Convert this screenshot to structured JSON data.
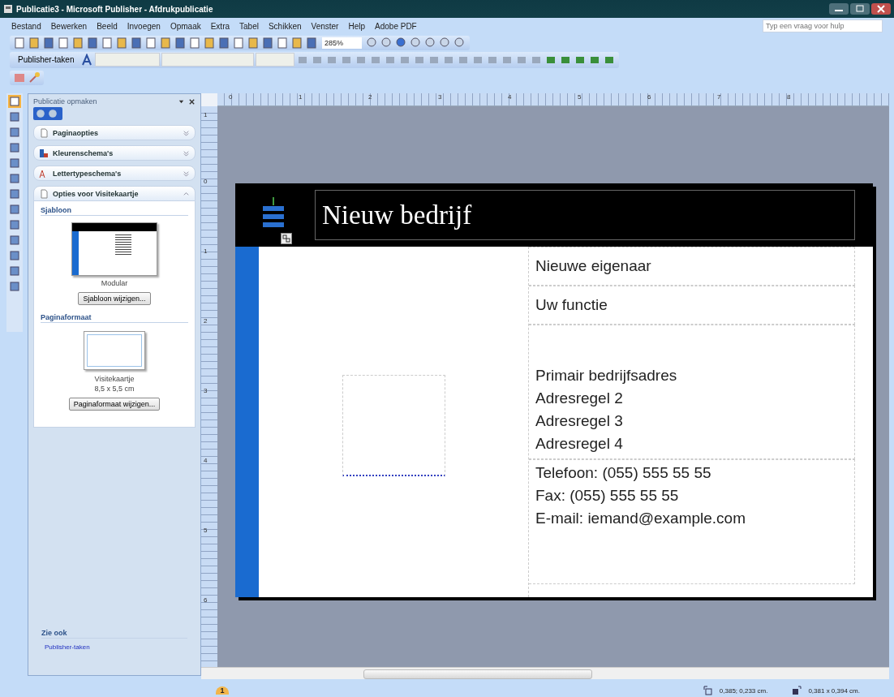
{
  "window": {
    "title": "Publicatie3 - Microsoft Publisher - Afdrukpublicatie"
  },
  "menu": [
    "Bestand",
    "Bewerken",
    "Beeld",
    "Invoegen",
    "Opmaak",
    "Extra",
    "Tabel",
    "Schikken",
    "Venster",
    "Help",
    "Adobe PDF"
  ],
  "help_search": {
    "placeholder": "Typ een vraag voor hulp"
  },
  "toolbar": {
    "zoom": "285%",
    "tasks_button": "Publisher-taken"
  },
  "task_pane": {
    "title": "Publicatie opmaken",
    "sections": [
      {
        "kind": "page",
        "label": "Paginaopties",
        "expanded": false
      },
      {
        "kind": "colors",
        "label": "Kleurenschema's",
        "expanded": false
      },
      {
        "kind": "fonts",
        "label": "Lettertypeschema's",
        "expanded": false
      },
      {
        "kind": "card",
        "label": "Opties voor Visitekaartje",
        "expanded": true
      }
    ],
    "template_heading": "Sjabloon",
    "template_name": "Modular",
    "template_button": "Sjabloon wijzigen...",
    "size_heading": "Paginaformaat",
    "size_name": "Visitekaartje",
    "size_value": "8,5 x 5,5 cm",
    "size_button": "Paginaformaat wijzigen...",
    "see_also_heading": "Zie ook",
    "see_also_links": [
      "Publisher-taken"
    ]
  },
  "rulers": {
    "horizontal": [
      "0",
      "1",
      "2",
      "3",
      "4",
      "5",
      "6",
      "7",
      "8"
    ],
    "vertical": [
      "1",
      "0",
      "1",
      "2",
      "3",
      "4",
      "5",
      "6"
    ]
  },
  "card": {
    "company": "Nieuw bedrijf",
    "owner": "Nieuwe eigenaar",
    "job_title": "Uw functie",
    "address": [
      "Primair bedrijfsadres",
      "Adresregel 2",
      "Adresregel 3",
      "Adresregel 4"
    ],
    "contact": [
      "Telefoon: (055) 555 55 55",
      "Fax: (055) 555 55 55",
      "E-mail: iemand@example.com"
    ]
  },
  "page_tab": "1",
  "status_bar": {
    "position": "0,385; 0,233 cm.",
    "size": "0,381 x 0,394 cm."
  }
}
